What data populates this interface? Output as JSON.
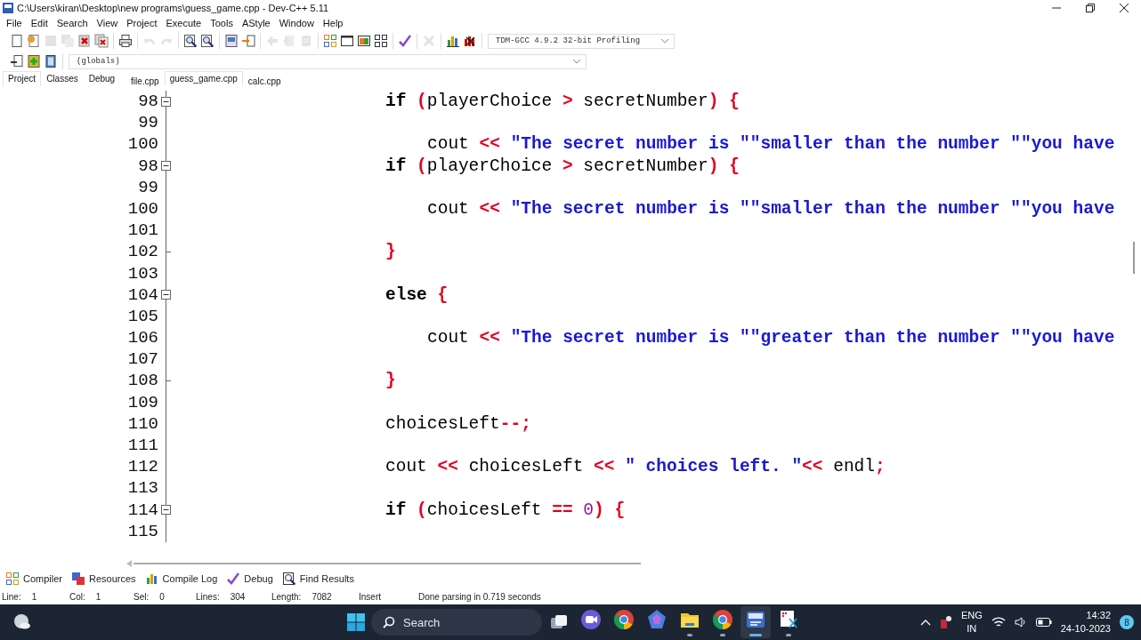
{
  "window": {
    "title": "C:\\Users\\kiran\\Desktop\\new programs\\guess_game.cpp - Dev-C++ 5.11"
  },
  "menu": [
    "File",
    "Edit",
    "Search",
    "View",
    "Project",
    "Execute",
    "Tools",
    "AStyle",
    "Window",
    "Help"
  ],
  "toolbar": {
    "groups": [
      [
        {
          "kind": "new",
          "disabled": false
        },
        {
          "kind": "open",
          "disabled": false
        },
        {
          "kind": "save",
          "disabled": true
        },
        {
          "kind": "save_all",
          "disabled": true
        },
        {
          "kind": "close",
          "disabled": false
        },
        {
          "kind": "close_all",
          "disabled": false
        }
      ],
      [
        {
          "kind": "print",
          "disabled": false
        }
      ],
      [
        {
          "kind": "undo",
          "disabled": true
        },
        {
          "kind": "redo",
          "disabled": true
        }
      ],
      [
        {
          "kind": "find",
          "disabled": false
        },
        {
          "kind": "replace",
          "disabled": false
        }
      ],
      [
        {
          "kind": "indent",
          "disabled": false
        },
        {
          "kind": "goto",
          "disabled": false
        }
      ],
      [
        {
          "kind": "back",
          "disabled": true
        },
        {
          "kind": "forward",
          "disabled": true
        },
        {
          "kind": "toggle",
          "disabled": true
        }
      ],
      [
        {
          "kind": "compile",
          "disabled": false
        },
        {
          "kind": "run",
          "disabled": false
        },
        {
          "kind": "compile_run",
          "disabled": false
        },
        {
          "kind": "rebuild",
          "disabled": false
        }
      ],
      [
        {
          "kind": "debug",
          "disabled": false
        }
      ],
      [
        {
          "kind": "stop",
          "disabled": true
        }
      ],
      [
        {
          "kind": "profile",
          "disabled": false
        },
        {
          "kind": "delete_profile",
          "disabled": false
        }
      ]
    ],
    "compiler": "TDM-GCC 4.9.2 32-bit Profiling"
  },
  "toolbar_2": {
    "buttons": [
      {
        "kind": "insert"
      },
      {
        "kind": "bookmark"
      },
      {
        "kind": "goto_bookmark"
      }
    ],
    "scope": "(globals)"
  },
  "panel_tabs": [
    {
      "label": "Project",
      "selected": true
    },
    {
      "label": "Classes",
      "selected": false
    },
    {
      "label": "Debug",
      "selected": false
    }
  ],
  "file_tabs": [
    {
      "label": "file.cpp",
      "selected": false
    },
    {
      "label": "guess_game.cpp",
      "selected": true
    },
    {
      "label": "calc.cpp",
      "selected": false
    }
  ],
  "editor": {
    "lines": [
      {
        "number": "98",
        "kind": "statement",
        "fold_start": true,
        "fold_end": false,
        "tokens": [
          {
            "kind": "kw",
            "text": "if "
          },
          {
            "kind": "op",
            "text": "("
          },
          {
            "kind": "id",
            "text": "playerChoice "
          },
          {
            "kind": "op",
            "text": "> "
          },
          {
            "kind": "id",
            "text": "secretNumber"
          },
          {
            "kind": "op",
            "text": ") {"
          }
        ]
      },
      {
        "number": "99",
        "kind": "blank",
        "fold_start": false,
        "fold_end": false
      },
      {
        "number": "100",
        "kind": "body",
        "fold_start": false,
        "fold_end": false,
        "tokens": [
          {
            "kind": "id",
            "text": "cout "
          },
          {
            "kind": "op",
            "text": "<< "
          },
          {
            "kind": "str",
            "text": "\"The secret number is \"\"smaller than the number \"\"you have"
          }
        ]
      },
      {
        "number": "98",
        "kind": "statement",
        "fold_start": true,
        "fold_end": false,
        "tokens": [
          {
            "kind": "kw",
            "text": "if "
          },
          {
            "kind": "op",
            "text": "("
          },
          {
            "kind": "id",
            "text": "playerChoice "
          },
          {
            "kind": "op",
            "text": "> "
          },
          {
            "kind": "id",
            "text": "secretNumber"
          },
          {
            "kind": "op",
            "text": ") {"
          }
        ]
      },
      {
        "number": "99",
        "kind": "blank",
        "fold_start": false,
        "fold_end": false
      },
      {
        "number": "100",
        "kind": "body",
        "fold_start": false,
        "fold_end": false,
        "tokens": [
          {
            "kind": "id",
            "text": "cout "
          },
          {
            "kind": "op",
            "text": "<< "
          },
          {
            "kind": "str",
            "text": "\"The secret number is \"\"smaller than the number \"\"you have"
          }
        ]
      },
      {
        "number": "101",
        "kind": "blank",
        "fold_start": false,
        "fold_end": false
      },
      {
        "number": "102",
        "kind": "statement",
        "fold_start": false,
        "fold_end": true,
        "tokens": [
          {
            "kind": "op",
            "text": "}"
          }
        ]
      },
      {
        "number": "103",
        "kind": "blank",
        "fold_start": false,
        "fold_end": false
      },
      {
        "number": "104",
        "kind": "statement",
        "fold_start": true,
        "fold_end": false,
        "tokens": [
          {
            "kind": "kw",
            "text": "else "
          },
          {
            "kind": "op",
            "text": "{"
          }
        ]
      },
      {
        "number": "105",
        "kind": "blank",
        "fold_start": false,
        "fold_end": false
      },
      {
        "number": "106",
        "kind": "body",
        "fold_start": false,
        "fold_end": false,
        "tokens": [
          {
            "kind": "id",
            "text": "cout "
          },
          {
            "kind": "op",
            "text": "<< "
          },
          {
            "kind": "str",
            "text": "\"The secret number is \"\"greater than the number \"\"you have"
          }
        ]
      },
      {
        "number": "107",
        "kind": "blank",
        "fold_start": false,
        "fold_end": false
      },
      {
        "number": "108",
        "kind": "statement",
        "fold_start": false,
        "fold_end": true,
        "tokens": [
          {
            "kind": "op",
            "text": "}"
          }
        ]
      },
      {
        "number": "109",
        "kind": "blank",
        "fold_start": false,
        "fold_end": false
      },
      {
        "number": "110",
        "kind": "statement",
        "fold_start": false,
        "fold_end": false,
        "tokens": [
          {
            "kind": "id",
            "text": "choicesLeft"
          },
          {
            "kind": "op",
            "text": "--;"
          }
        ]
      },
      {
        "number": "111",
        "kind": "blank",
        "fold_start": false,
        "fold_end": false
      },
      {
        "number": "112",
        "kind": "statement",
        "fold_start": false,
        "fold_end": false,
        "tokens": [
          {
            "kind": "id",
            "text": "cout "
          },
          {
            "kind": "op",
            "text": "<< "
          },
          {
            "kind": "id",
            "text": "choicesLeft "
          },
          {
            "kind": "op",
            "text": "<< "
          },
          {
            "kind": "str",
            "text": "\" choices left. \""
          },
          {
            "kind": "op",
            "text": "<< "
          },
          {
            "kind": "id",
            "text": "endl"
          },
          {
            "kind": "op",
            "text": ";"
          }
        ]
      },
      {
        "number": "113",
        "kind": "blank",
        "fold_start": false,
        "fold_end": false
      },
      {
        "number": "114",
        "kind": "statement",
        "fold_start": true,
        "fold_end": false,
        "tokens": [
          {
            "kind": "kw",
            "text": "if "
          },
          {
            "kind": "op",
            "text": "("
          },
          {
            "kind": "id",
            "text": "choicesLeft "
          },
          {
            "kind": "op",
            "text": "== "
          },
          {
            "kind": "num",
            "text": "0"
          },
          {
            "kind": "op",
            "text": ") {"
          }
        ]
      },
      {
        "number": "115",
        "kind": "blank",
        "fold_start": false,
        "fold_end": false
      }
    ]
  },
  "bottom_tabs": [
    {
      "kind": "compiler",
      "label": "Compiler"
    },
    {
      "kind": "resources",
      "label": "Resources"
    },
    {
      "kind": "log",
      "label": "Compile Log"
    },
    {
      "kind": "debug",
      "label": "Debug"
    },
    {
      "kind": "find",
      "label": "Find Results"
    }
  ],
  "status_bar": {
    "fields": [
      {
        "label": "Line:",
        "value": "1"
      },
      {
        "label": "Col:",
        "value": "1"
      },
      {
        "label": "Sel:",
        "value": "0"
      },
      {
        "label": "Lines:",
        "value": "304"
      },
      {
        "label": "Length:",
        "value": "7082"
      }
    ],
    "mode": "Insert",
    "message": "Done parsing in 0.719 seconds"
  },
  "taskbar": {
    "search": {
      "placeholder": "Search"
    },
    "apps": [
      {
        "kind": "camera",
        "running": false,
        "selected": false
      },
      {
        "kind": "browser",
        "running": false,
        "selected": false
      },
      {
        "kind": "swirl",
        "running": false,
        "selected": false
      },
      {
        "kind": "folder",
        "running": true,
        "selected": false
      },
      {
        "kind": "browser",
        "running": true,
        "selected": false
      },
      {
        "kind": "editor",
        "running": true,
        "selected": true
      },
      {
        "kind": "snip",
        "running": true,
        "selected": false
      }
    ],
    "language": "ENG",
    "region": "IN",
    "time": "14:32",
    "date": "24-10-2023",
    "notifications": "8"
  }
}
